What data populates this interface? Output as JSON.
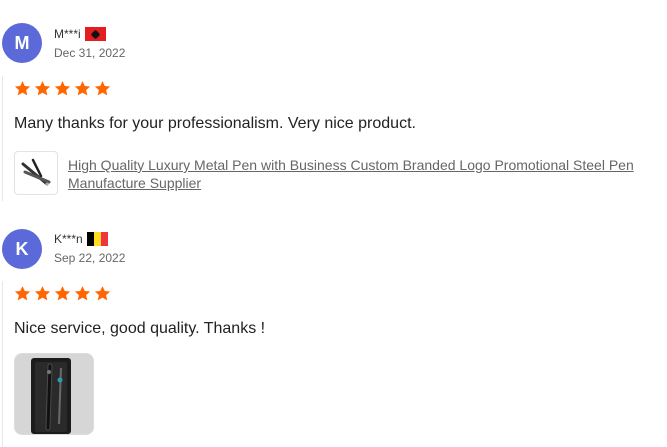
{
  "reviews": [
    {
      "avatar_letter": "M",
      "username": "M***i",
      "country_flag": "albania-flag-icon",
      "date": "Dec 31, 2022",
      "rating": 5,
      "comment": "Many thanks for your professionalism. Very nice product.",
      "product": {
        "thumb_icon": "metal-pens-icon",
        "title": "High Quality Luxury Metal Pen with Business Custom Branded Logo Promotional Steel Pen Manufacture Supplier"
      }
    },
    {
      "avatar_letter": "K",
      "username": "K***n",
      "country_flag": "belgium-flag-icon",
      "date": "Sep 22, 2022",
      "rating": 5,
      "comment": "Nice service, good quality. Thanks !",
      "photo_icon": "review-photo-pen-in-box"
    }
  ],
  "colors": {
    "avatar": "#5b6ad8",
    "star": "#ff6600"
  }
}
